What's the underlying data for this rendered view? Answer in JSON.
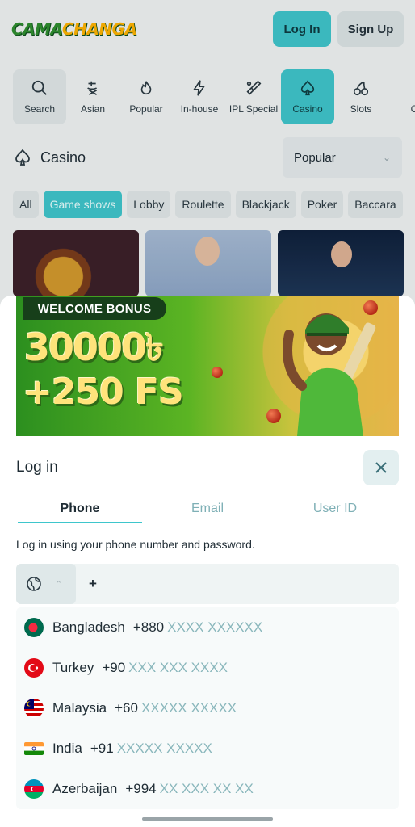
{
  "header": {
    "logo_part1": "CAMA",
    "logo_part2": "CHANGA",
    "login_label": "Log In",
    "signup_label": "Sign Up"
  },
  "categories": [
    {
      "label": "Search",
      "icon": "search-icon"
    },
    {
      "label": "Asian",
      "icon": "asian-icon"
    },
    {
      "label": "Popular",
      "icon": "flame-icon"
    },
    {
      "label": "In-house",
      "icon": "lightning-icon"
    },
    {
      "label": "IPL Special",
      "icon": "cricket-bat-icon"
    },
    {
      "label": "Casino",
      "icon": "spade-icon",
      "active": true
    },
    {
      "label": "Slots",
      "icon": "cherries-icon"
    },
    {
      "label": "C",
      "icon": "more-icon"
    }
  ],
  "section": {
    "title": "Casino",
    "sort_value": "Popular"
  },
  "chips": [
    "All",
    "Game shows",
    "Lobby",
    "Roulette",
    "Blackjack",
    "Poker",
    "Baccara"
  ],
  "chips_active_index": 1,
  "banner": {
    "tag": "WELCOME BONUS",
    "amount": "30000৳",
    "free_spins": "+250 FS"
  },
  "login": {
    "title": "Log in",
    "tabs": [
      "Phone",
      "Email",
      "User ID"
    ],
    "active_tab": "Phone",
    "hint": "Log in using your phone number and password.",
    "phone_prefix": "+"
  },
  "countries": [
    {
      "name": "Bangladesh",
      "code": "+880",
      "mask": "XXXX XXXXXX",
      "flag": "bangladesh-flag-icon"
    },
    {
      "name": "Turkey",
      "code": "+90",
      "mask": "XXX XXX XXXX",
      "flag": "turkey-flag-icon"
    },
    {
      "name": "Malaysia",
      "code": "+60",
      "mask": "XXXXX XXXXX",
      "flag": "malaysia-flag-icon"
    },
    {
      "name": "India",
      "code": "+91",
      "mask": "XXXXX XXXXX",
      "flag": "india-flag-icon"
    },
    {
      "name": "Azerbaijan",
      "code": "+994",
      "mask": "XX XXX XX XX",
      "flag": "azerbaijan-flag-icon"
    }
  ],
  "colors": {
    "accent": "#3ec6cc",
    "text": "#1f2c34",
    "muted_mask": "#8ab7bc"
  }
}
